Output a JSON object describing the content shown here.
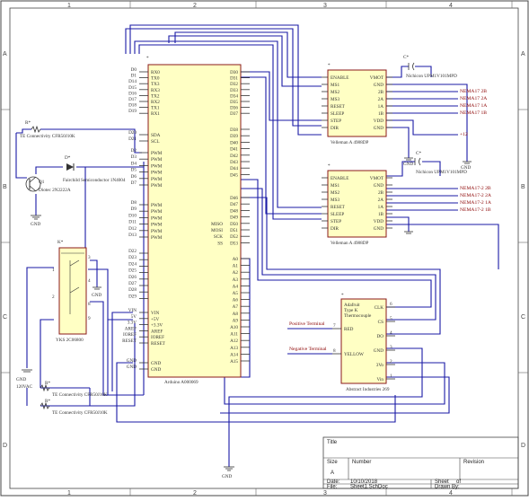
{
  "frame": {
    "zones_rows": [
      "A",
      "B",
      "C",
      "D"
    ],
    "zones_cols": [
      "1",
      "2",
      "3",
      "4"
    ]
  },
  "arduino": {
    "ref": "*",
    "name": "Arduino A000069",
    "left_top": [
      "D0",
      "D1",
      "D14",
      "D15",
      "D16",
      "D17",
      "D18",
      "D19"
    ],
    "left_top_fn": [
      "RX0",
      "TX0",
      "TX3",
      "RX3",
      "TX2",
      "RX2",
      "TX1",
      "RX1"
    ],
    "left_i2c": [
      "D20",
      "D21"
    ],
    "left_i2c_fn": [
      "SDA",
      "SCL"
    ],
    "left_pwm1": [
      "D2",
      "D3",
      "D4",
      "D5",
      "D6",
      "D7"
    ],
    "left_pwm2": [
      "D8",
      "D9",
      "D10",
      "D11",
      "D12",
      "D13"
    ],
    "left_pwm_fn": "PWM",
    "left_dig": [
      "D22",
      "D23",
      "D24",
      "D25",
      "D26",
      "D27",
      "D28",
      "D29"
    ],
    "left_power": [
      "VIN",
      "5V",
      "3.3V",
      "AREF",
      "IOREF",
      "RESET"
    ],
    "left_power_fn": [
      "VIN",
      "+5V",
      "+3.3V",
      "AREF",
      "IOREF",
      "RESET"
    ],
    "left_gnd": [
      "GND",
      "GND"
    ],
    "left_gnd_fn": [
      "GND",
      "GND"
    ],
    "right_top": [
      "D30",
      "D31",
      "D32",
      "D33",
      "D34",
      "D35",
      "D36",
      "D37"
    ],
    "right_mid": [
      "D38",
      "D39",
      "D40",
      "D41",
      "D42",
      "D43",
      "D44",
      "D45"
    ],
    "right_mid2": [
      "D46",
      "D47",
      "D48",
      "D49",
      "D50",
      "D51",
      "D52",
      "D53"
    ],
    "right_mid2_fn": [
      "",
      "",
      "",
      "",
      "MISO",
      "MOSI",
      "SCK",
      "SS"
    ],
    "right_analog": [
      "A0",
      "A1",
      "A2",
      "A3",
      "A4",
      "A5",
      "A6",
      "A7",
      "A8",
      "A9",
      "A10",
      "A11",
      "A12",
      "A13",
      "A14",
      "A15"
    ]
  },
  "driver1": {
    "ref": "*",
    "name": "Velleman A 4988DP",
    "left": [
      "ENABLE",
      "MS1",
      "MS2",
      "MS3",
      "RESET",
      "SLEEP",
      "STEP",
      "DIR"
    ],
    "right": [
      "VMOT",
      "GND",
      "2B",
      "2A",
      "1A",
      "1B",
      "VDD",
      "GND"
    ]
  },
  "driver2": {
    "ref": "*",
    "name": "Velleman A 4988DP",
    "left": [
      "ENABLE",
      "MS1",
      "MS2",
      "MS3",
      "RESET",
      "SLEEP",
      "STEP",
      "DIR"
    ],
    "right": [
      "VMOT",
      "GND",
      "2B",
      "2A",
      "1A",
      "1B",
      "VDD",
      "GND"
    ]
  },
  "thermo": {
    "ref": "*",
    "title_lines": [
      "Adafruit",
      "Type K",
      "Thermocouple"
    ],
    "left": [
      "RED",
      "YELLOW"
    ],
    "left_nums": [
      "7",
      "8"
    ],
    "right": [
      "CLK",
      "CS",
      "DO",
      "GND",
      "3Vo",
      "Vin"
    ],
    "right_nums": [
      "6",
      "5",
      "4",
      "3",
      "2",
      "1"
    ],
    "name": "Abstract Industries 269"
  },
  "labels": {
    "cap1": "C*",
    "cap1_name": "Nichicon UPM1V101MPD",
    "cap2": "C*",
    "cap2_name": "Nichicon UPM1V101MPD",
    "nema1": [
      "NEMA17 2B",
      "NEMA17 2A",
      "NEMA17 1A",
      "NEMA17 1B"
    ],
    "nema2": [
      "NEMA17-2 2B",
      "NEMA17-2 2A",
      "NEMA17-2 1A",
      "NEMA17-2 1B"
    ],
    "plus12": "+12",
    "r_top": "R*",
    "r_top_name": "TE Connectivity CFR50J10K",
    "diode": "D*",
    "diode_name": "Fairchild Semiconductor 1N4004",
    "q1": "Q1",
    "q1_name": "Diotec 2N2222A",
    "relay": "K*",
    "relay_name": "YKS 2C06800",
    "r_b1": "R*",
    "r_b1_name": "TE Connectivity CFR50J10K",
    "r_b2": "R*",
    "r_b2_name": "TE Connectivity CFR50J10K",
    "gnd": "GND",
    "ac_in": "120VAC",
    "pos_t": "Positive Terminal",
    "neg_t": "Negative Terminal"
  },
  "title_block": {
    "title": "Title",
    "size_label": "Size",
    "size_value": "A",
    "number_label": "Number",
    "revision_label": "Revision",
    "date_label": "Date:",
    "date_value": "10/10/2018",
    "file_label": "File:",
    "file_value": "Sheet1.SchDoc",
    "sheet_label": "Sheet",
    "of_label": "of",
    "drawn_label": "Drawn By:"
  }
}
